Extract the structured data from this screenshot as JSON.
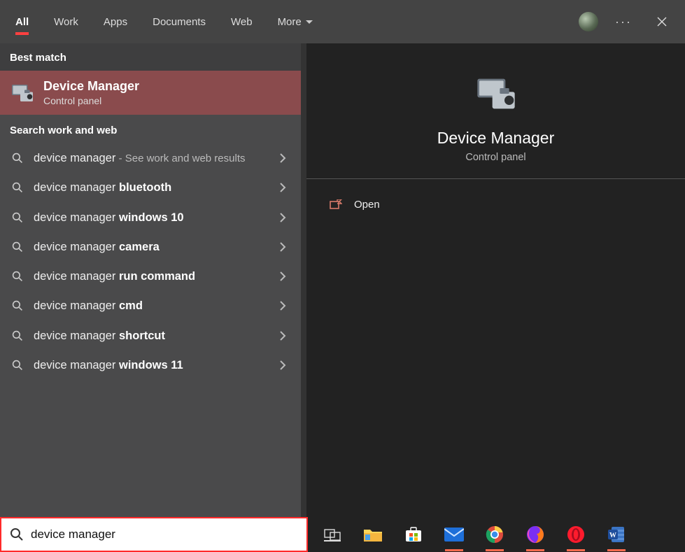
{
  "tabs": {
    "all": "All",
    "work": "Work",
    "apps": "Apps",
    "documents": "Documents",
    "web": "Web",
    "more": "More"
  },
  "left": {
    "best_match_header": "Best match",
    "best_match": {
      "title": "Device Manager",
      "subtitle": "Control panel"
    },
    "search_header": "Search work and web",
    "suggestions": [
      {
        "prefix": "device manager",
        "bold": "",
        "hint": " - See work and web results"
      },
      {
        "prefix": "device manager ",
        "bold": "bluetooth",
        "hint": ""
      },
      {
        "prefix": "device manager ",
        "bold": "windows 10",
        "hint": ""
      },
      {
        "prefix": "device manager ",
        "bold": "camera",
        "hint": ""
      },
      {
        "prefix": "device manager ",
        "bold": "run command",
        "hint": ""
      },
      {
        "prefix": "device manager ",
        "bold": "cmd",
        "hint": ""
      },
      {
        "prefix": "device manager ",
        "bold": "shortcut",
        "hint": ""
      },
      {
        "prefix": "device manager ",
        "bold": "windows 11",
        "hint": ""
      }
    ]
  },
  "right": {
    "title": "Device Manager",
    "subtitle": "Control panel",
    "actions": {
      "open": "Open"
    }
  },
  "search": {
    "value": "device manager"
  },
  "taskbar": {
    "items": [
      "task-view",
      "file-explorer",
      "microsoft-store",
      "mail",
      "chrome",
      "firefox",
      "opera",
      "word"
    ]
  }
}
